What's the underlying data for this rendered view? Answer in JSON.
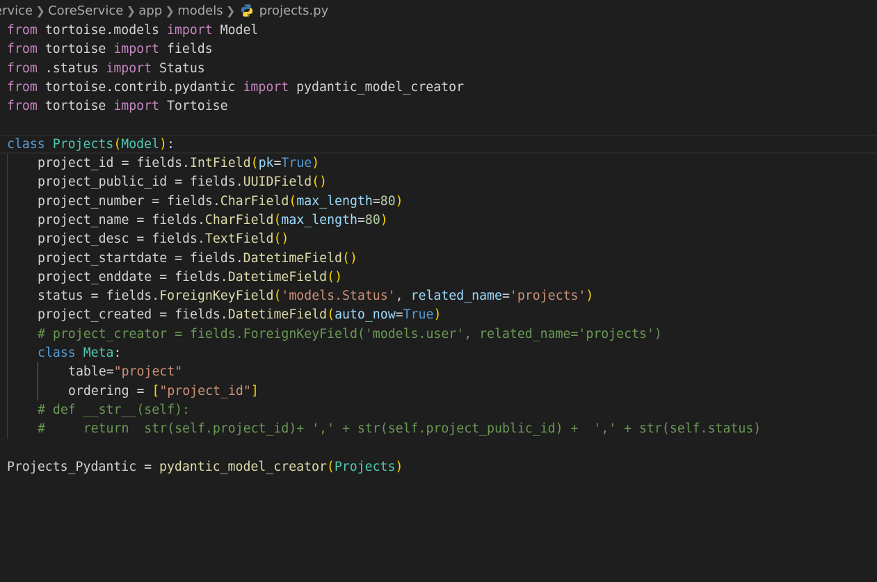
{
  "breadcrumb": {
    "items": [
      "ervice",
      "CoreService",
      "app",
      "models"
    ],
    "file": "projects.py",
    "separator": ">",
    "file_icon": "python-icon"
  },
  "code": {
    "l1": {
      "kw": "from",
      "mod": " tortoise.models ",
      "imp": "import",
      "rest": " Model"
    },
    "l2": {
      "kw": "from",
      "mod": " tortoise ",
      "imp": "import",
      "rest": " fields"
    },
    "l3": {
      "kw": "from",
      "mod": " .status ",
      "imp": "import",
      "rest": " Status"
    },
    "l4": {
      "kw": "from",
      "mod": " tortoise.contrib.pydantic ",
      "imp": "import",
      "rest": " pydantic_model_creator"
    },
    "l5": {
      "kw": "from",
      "mod": " tortoise ",
      "imp": "import",
      "rest": " Tortoise"
    },
    "l7": {
      "kw": "class",
      "name": "Projects",
      "po": "(",
      "base": "Model",
      "pc": ")",
      "colon": ":"
    },
    "l8": {
      "lhs": "project_id = fields.",
      "fn": "IntField",
      "po": "(",
      "k": "pk",
      "eq": "=",
      "v": "True",
      "pc": ")"
    },
    "l9": {
      "lhs": "project_public_id = fields.",
      "fn": "UUIDField",
      "po": "(",
      "pc": ")"
    },
    "l10": {
      "lhs": "project_number = fields.",
      "fn": "CharField",
      "po": "(",
      "k": "max_length",
      "eq": "=",
      "v": "80",
      "pc": ")"
    },
    "l11": {
      "lhs": "project_name = fields.",
      "fn": "CharField",
      "po": "(",
      "k": "max_length",
      "eq": "=",
      "v": "80",
      "pc": ")"
    },
    "l12": {
      "lhs": "project_desc = fields.",
      "fn": "TextField",
      "po": "(",
      "pc": ")"
    },
    "l13": {
      "lhs": "project_startdate = fields.",
      "fn": "DatetimeField",
      "po": "(",
      "pc": ")"
    },
    "l14": {
      "lhs": "project_enddate = fields.",
      "fn": "DatetimeField",
      "po": "(",
      "pc": ")"
    },
    "l15": {
      "lhs": "status = fields.",
      "fn": "ForeignKeyField",
      "po": "(",
      "s1": "'models.Status'",
      "comma": ", ",
      "k": "related_name",
      "eq": "=",
      "s2": "'projects'",
      "pc": ")"
    },
    "l16": {
      "lhs": "project_created = fields.",
      "fn": "DatetimeField",
      "po": "(",
      "k": "auto_now",
      "eq": "=",
      "v": "True",
      "pc": ")"
    },
    "l17": {
      "comment": "# project_creator = fields.ForeignKeyField('models.user', related_name='projects')"
    },
    "l18": {
      "kw": "class",
      "name": "Meta",
      "colon": ":"
    },
    "l19": {
      "lhs": "table=",
      "s": "\"project\""
    },
    "l20": {
      "lhs": "ordering = ",
      "bo": "[",
      "s": "\"project_id\"",
      "bc": "]"
    },
    "l21": {
      "comment": "# def __str__(self):"
    },
    "l22": {
      "comment": "#     return  str(self.project_id)+ ',' + str(self.project_public_id) +  ',' + str(self.status)"
    },
    "l24": {
      "lhs": "Projects_Pydantic = ",
      "fn": "pydantic_model_creator",
      "po": "(",
      "arg": "Projects",
      "pc": ")"
    }
  },
  "colors": {
    "background": "#1e1e1e",
    "keyword_control": "#c586c0",
    "keyword_storage": "#569cd6",
    "class_name": "#4ec9b0",
    "function": "#dcdcaa",
    "parameter": "#9cdcfe",
    "string": "#ce9178",
    "number": "#b5cea8",
    "comment": "#6a9955",
    "bracket_level_1": "#ffd700",
    "bracket_level_2": "#da70d6"
  }
}
